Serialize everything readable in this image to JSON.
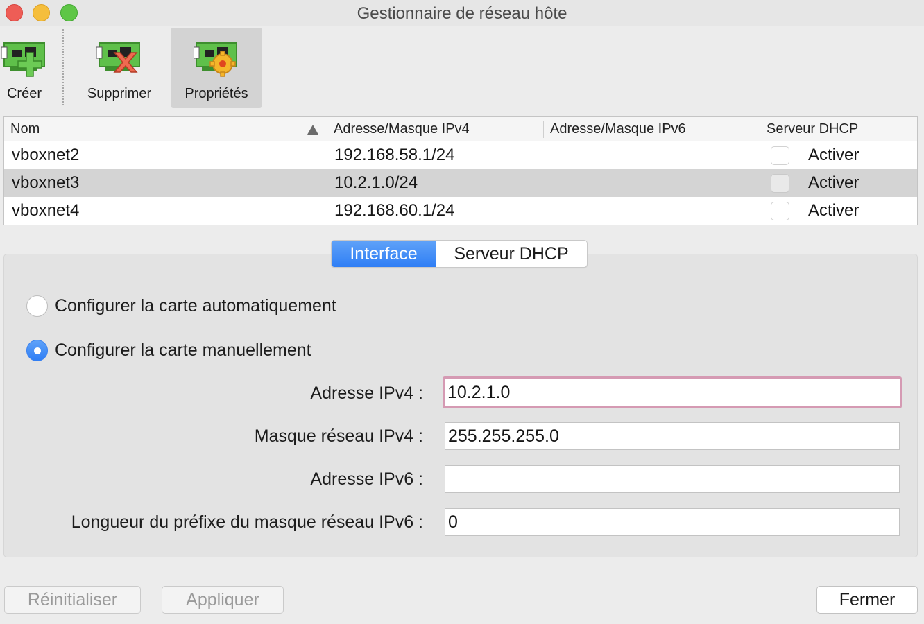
{
  "window": {
    "title": "Gestionnaire de réseau hôte"
  },
  "toolbar": {
    "items": [
      {
        "label": "Créer",
        "icon": "network-card-add-icon"
      },
      {
        "label": "Supprimer",
        "icon": "network-card-remove-icon"
      },
      {
        "label": "Propriétés",
        "icon": "network-card-properties-icon",
        "active": true
      }
    ]
  },
  "table": {
    "columns": [
      "Nom",
      "Adresse/Masque IPv4",
      "Adresse/Masque IPv6",
      "Serveur DHCP"
    ],
    "rows": [
      {
        "name": "vboxnet2",
        "ipv4": "192.168.58.1/24",
        "ipv6": "",
        "dhcp_label": "Activer",
        "dhcp_enabled": false
      },
      {
        "name": "vboxnet3",
        "ipv4": "10.2.1.0/24",
        "ipv6": "",
        "dhcp_label": "Activer",
        "dhcp_enabled": false,
        "selected": true
      },
      {
        "name": "vboxnet4",
        "ipv4": "192.168.60.1/24",
        "ipv6": "",
        "dhcp_label": "Activer",
        "dhcp_enabled": false
      }
    ]
  },
  "tabs": [
    {
      "label": "Interface",
      "active": true
    },
    {
      "label": "Serveur DHCP",
      "active": false
    }
  ],
  "interface": {
    "auto_label": "Configurer la carte automatiquement",
    "manual_label": "Configurer la carte manuellement",
    "selected_mode": "manual",
    "fields": {
      "ipv4_address": {
        "label": "Adresse IPv4 :",
        "value": "10.2.1.0"
      },
      "ipv4_mask": {
        "label": "Masque réseau IPv4 :",
        "value": "255.255.255.0"
      },
      "ipv6_address": {
        "label": "Adresse IPv6 :",
        "value": ""
      },
      "ipv6_prefix": {
        "label": "Longueur du préfixe du masque réseau IPv6 :",
        "value": "0"
      }
    }
  },
  "buttons": {
    "reset": "Réinitialiser",
    "apply": "Appliquer",
    "close": "Fermer"
  },
  "colors": {
    "accent": "#2f7ef5",
    "focus_ring": "#d59ab3",
    "selected_row": "#d4d4d4"
  }
}
